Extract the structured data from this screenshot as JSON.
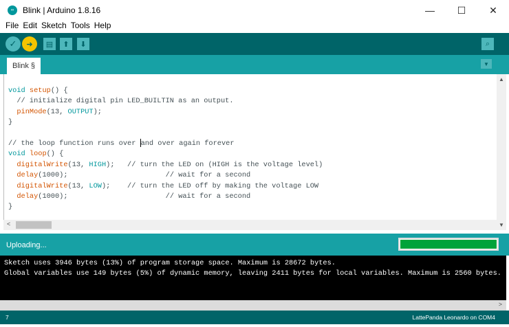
{
  "window": {
    "title": "Blink | Arduino 1.8.16",
    "minimize": "—",
    "maximize": "☐",
    "close": "✕"
  },
  "menu": [
    "File",
    "Edit",
    "Sketch",
    "Tools",
    "Help"
  ],
  "toolbar": {
    "verify": "✓",
    "upload": "➜",
    "new": "▤",
    "open": "⬆",
    "save": "⬇",
    "serial_monitor": "⌕"
  },
  "tabs": [
    {
      "label": "Blink §"
    }
  ],
  "code": [
    [
      {
        "t": "kw",
        "v": "void"
      },
      {
        "t": "",
        "v": " "
      },
      {
        "t": "fn",
        "v": "setup"
      },
      {
        "t": "",
        "v": "() {"
      }
    ],
    [
      {
        "t": "cm",
        "v": "  // initialize digital pin LED_BUILTIN as an output."
      }
    ],
    [
      {
        "t": "",
        "v": "  "
      },
      {
        "t": "fn",
        "v": "pinMode"
      },
      {
        "t": "",
        "v": "(13, "
      },
      {
        "t": "kw",
        "v": "OUTPUT"
      },
      {
        "t": "",
        "v": ");"
      }
    ],
    [
      {
        "t": "",
        "v": "}"
      }
    ],
    [
      {
        "t": "",
        "v": ""
      }
    ],
    [
      {
        "t": "cm",
        "v": "// the loop function runs over "
      },
      {
        "t": "cursor",
        "v": ""
      },
      {
        "t": "cm",
        "v": "and over again forever"
      }
    ],
    [
      {
        "t": "kw",
        "v": "void"
      },
      {
        "t": "",
        "v": " "
      },
      {
        "t": "fn",
        "v": "loop"
      },
      {
        "t": "",
        "v": "() {"
      }
    ],
    [
      {
        "t": "",
        "v": "  "
      },
      {
        "t": "fn",
        "v": "digitalWrite"
      },
      {
        "t": "",
        "v": "(13, "
      },
      {
        "t": "kw",
        "v": "HIGH"
      },
      {
        "t": "",
        "v": ");   "
      },
      {
        "t": "cm",
        "v": "// turn the LED on (HIGH is the voltage level)"
      }
    ],
    [
      {
        "t": "",
        "v": "  "
      },
      {
        "t": "fn",
        "v": "delay"
      },
      {
        "t": "",
        "v": "(1000);                       "
      },
      {
        "t": "cm",
        "v": "// wait for a second"
      }
    ],
    [
      {
        "t": "",
        "v": "  "
      },
      {
        "t": "fn",
        "v": "digitalWrite"
      },
      {
        "t": "",
        "v": "(13, "
      },
      {
        "t": "kw",
        "v": "LOW"
      },
      {
        "t": "",
        "v": ");    "
      },
      {
        "t": "cm",
        "v": "// turn the LED off by making the voltage LOW"
      }
    ],
    [
      {
        "t": "",
        "v": "  "
      },
      {
        "t": "fn",
        "v": "delay"
      },
      {
        "t": "",
        "v": "(1000);                       "
      },
      {
        "t": "cm",
        "v": "// wait for a second"
      }
    ],
    [
      {
        "t": "",
        "v": "}"
      }
    ]
  ],
  "status": {
    "message": "Uploading...",
    "progress_percent": 100
  },
  "console": [
    "Sketch uses 3946 bytes (13%) of program storage space. Maximum is 28672 bytes.",
    "Global variables use 149 bytes (5%) of dynamic memory, leaving 2411 bytes for local variables. Maximum is 2560 bytes."
  ],
  "footer": {
    "line": "7",
    "board": "LattePanda Leonardo on COM4"
  },
  "scroll": {
    "up": "▲",
    "down": "▼",
    "left": "<",
    "right": ">"
  }
}
